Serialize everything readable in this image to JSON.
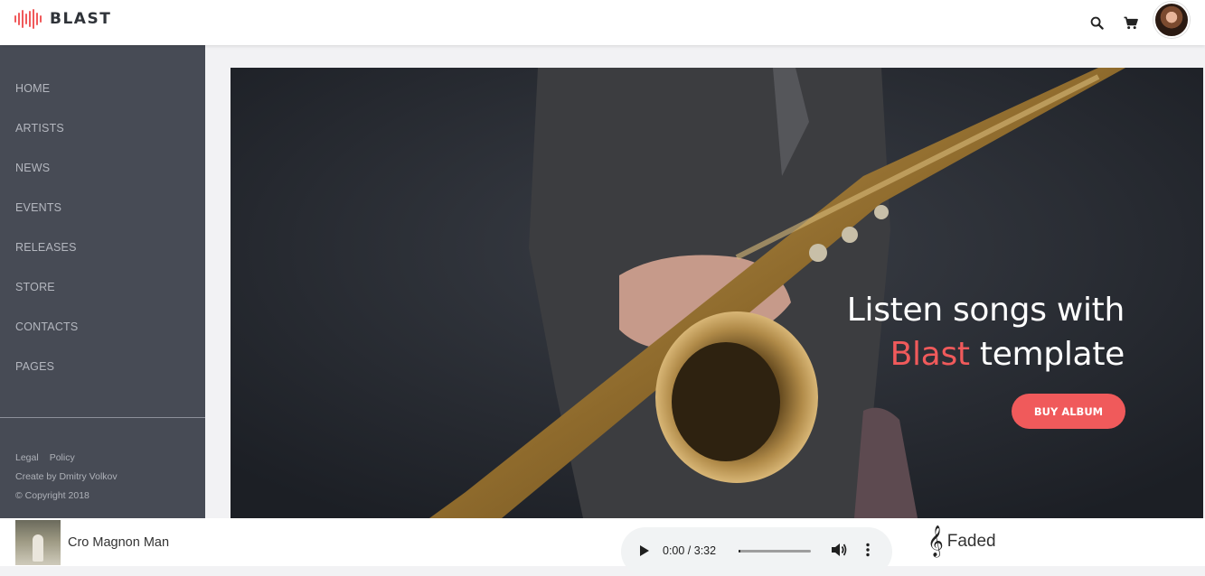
{
  "brand": {
    "name": "BLAST",
    "accent": "#f05a5b"
  },
  "header": {
    "icons": [
      "search-icon",
      "cart-icon"
    ]
  },
  "sidebar": {
    "items": [
      {
        "label": "HOME"
      },
      {
        "label": "ARTISTS"
      },
      {
        "label": "NEWS"
      },
      {
        "label": "EVENTS"
      },
      {
        "label": "RELEASES"
      },
      {
        "label": "STORE"
      },
      {
        "label": "CONTACTS"
      },
      {
        "label": "PAGES"
      }
    ],
    "footer": {
      "legal": "Legal",
      "policy": "Policy",
      "credit": "Create by Dmitry Volkov",
      "copyright": "© Copyright 2018"
    }
  },
  "hero": {
    "title_line1": "Listen songs with",
    "title_accent": "Blast",
    "title_rest": "template",
    "button": "BUY ALBUM"
  },
  "player": {
    "track_title": "Cro Magnon Man",
    "time": "0:00 / 3:32",
    "progress": 0.0,
    "now_playing": "Faded",
    "now_icon": "treble-clef-icon"
  }
}
